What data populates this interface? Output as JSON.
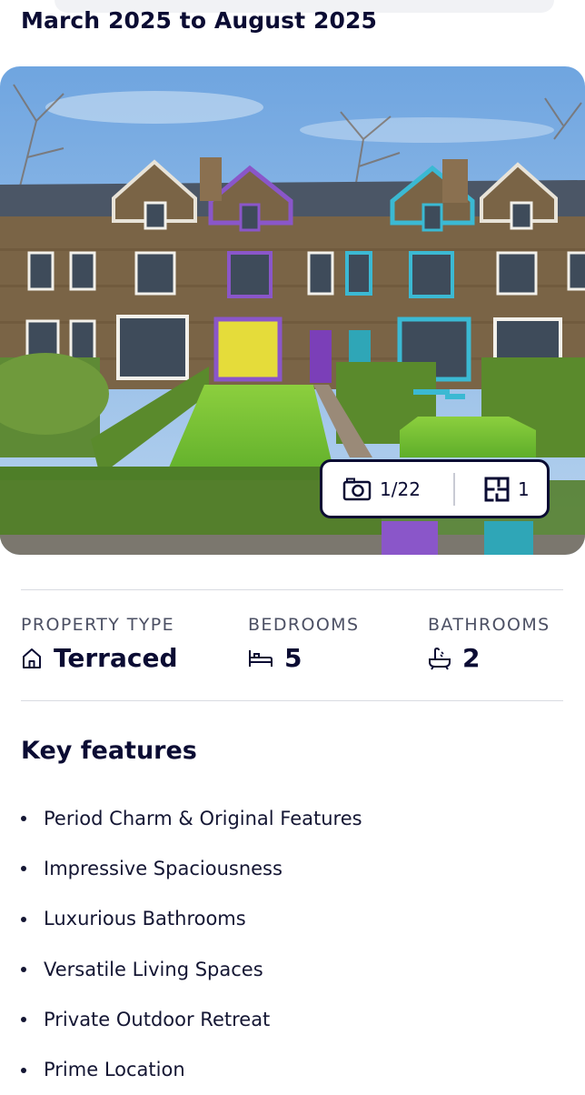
{
  "page": {
    "date_range": "March 2025 to August 2025"
  },
  "gallery": {
    "photo_count": "1/22",
    "floorplan_count": "1",
    "camera_icon": "camera-icon",
    "floorplan_icon": "floorplan-icon"
  },
  "stats": [
    {
      "label": "PROPERTY TYPE",
      "value": "Terraced",
      "icon": "house-icon"
    },
    {
      "label": "BEDROOMS",
      "value": "5",
      "icon": "bed-icon"
    },
    {
      "label": "BATHROOMS",
      "value": "2",
      "icon": "bath-icon"
    }
  ],
  "key_features": {
    "title": "Key features",
    "items": [
      "Period Charm & Original Features",
      "Impressive Spaciousness",
      "Luxurious Bathrooms",
      "Versatile Living Spaces",
      "Private Outdoor Retreat",
      "Prime Location"
    ]
  },
  "colors": {
    "text": "#0b0c33",
    "muted": "#4c5064",
    "divider": "#d9dbe2"
  }
}
